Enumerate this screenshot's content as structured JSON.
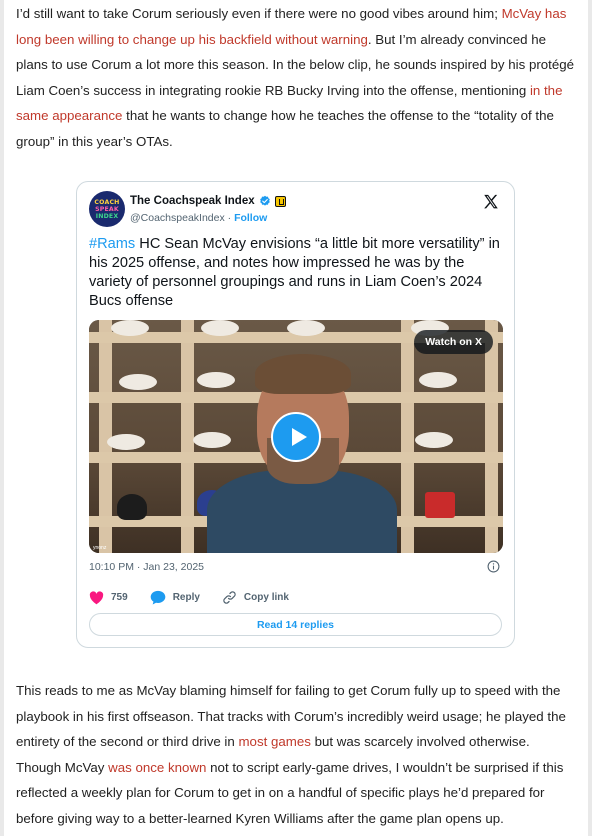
{
  "article": {
    "p1": [
      {
        "text": "I’d still want to take Corum seriously even if there were no good vibes around him; "
      },
      {
        "text": "McVay has long been willing to change up his backfield without warning",
        "link": true
      },
      {
        "text": ". But I’m already convinced he plans to use Corum a lot more this season. In the below clip, he sounds inspired by his protégé Liam Coen’s success in integrating rookie RB Bucky Irving into the offense, mentioning "
      },
      {
        "text": "in the same appearance",
        "link": true
      },
      {
        "text": " that he wants to change how he teaches the offense to the “totality of the group” in this year’s OTAs."
      }
    ],
    "p2": [
      {
        "text": "This reads to me as McVay blaming himself for failing to get Corum fully up to speed with the playbook in his first offseason. That tracks with Corum’s incredibly weird usage; he played the entirety of the second or third drive in "
      },
      {
        "text": "most games",
        "link": true
      },
      {
        "text": " but was scarcely involved otherwise. Though McVay "
      },
      {
        "text": "was once known",
        "link": true
      },
      {
        "text": " not to script early-game drives, I wouldn’t be surprised if this reflected a weekly plan for Corum to get in on a handful of specific plays he’d prepared for before giving way to a better-learned Kyren Williams after the game plan opens up."
      }
    ]
  },
  "tweet": {
    "avatar_lines": [
      "COACH",
      "SPEAK",
      "INDEX"
    ],
    "name": "The Coachspeak Index",
    "handle": "@CoachspeakIndex",
    "separator": "·",
    "follow_label": "Follow",
    "hashtag": "#Rams",
    "text": " HC Sean McVay envisions “a little bit more versatility” in his 2025 offense, and notes how impressed he was by the variety of personnel groupings and runs in Liam Coen’s 2024 Bucs offense",
    "watch_label": "Watch on X",
    "video_watermark": "ynonz",
    "timestamp": "10:10 PM · Jan 23, 2025",
    "likes": "759",
    "reply_label": "Reply",
    "copy_link_label": "Copy link",
    "read_replies_label": "Read 14 replies"
  },
  "colors": {
    "link": "#c0392b",
    "x_blue": "#1d9bf0",
    "heart": "#f91880"
  },
  "icons": [
    "x-logo-icon",
    "verified-badge-icon",
    "affiliate-badge-icon",
    "play-icon",
    "info-icon",
    "heart-icon",
    "reply-bubble-icon",
    "copy-link-icon"
  ]
}
